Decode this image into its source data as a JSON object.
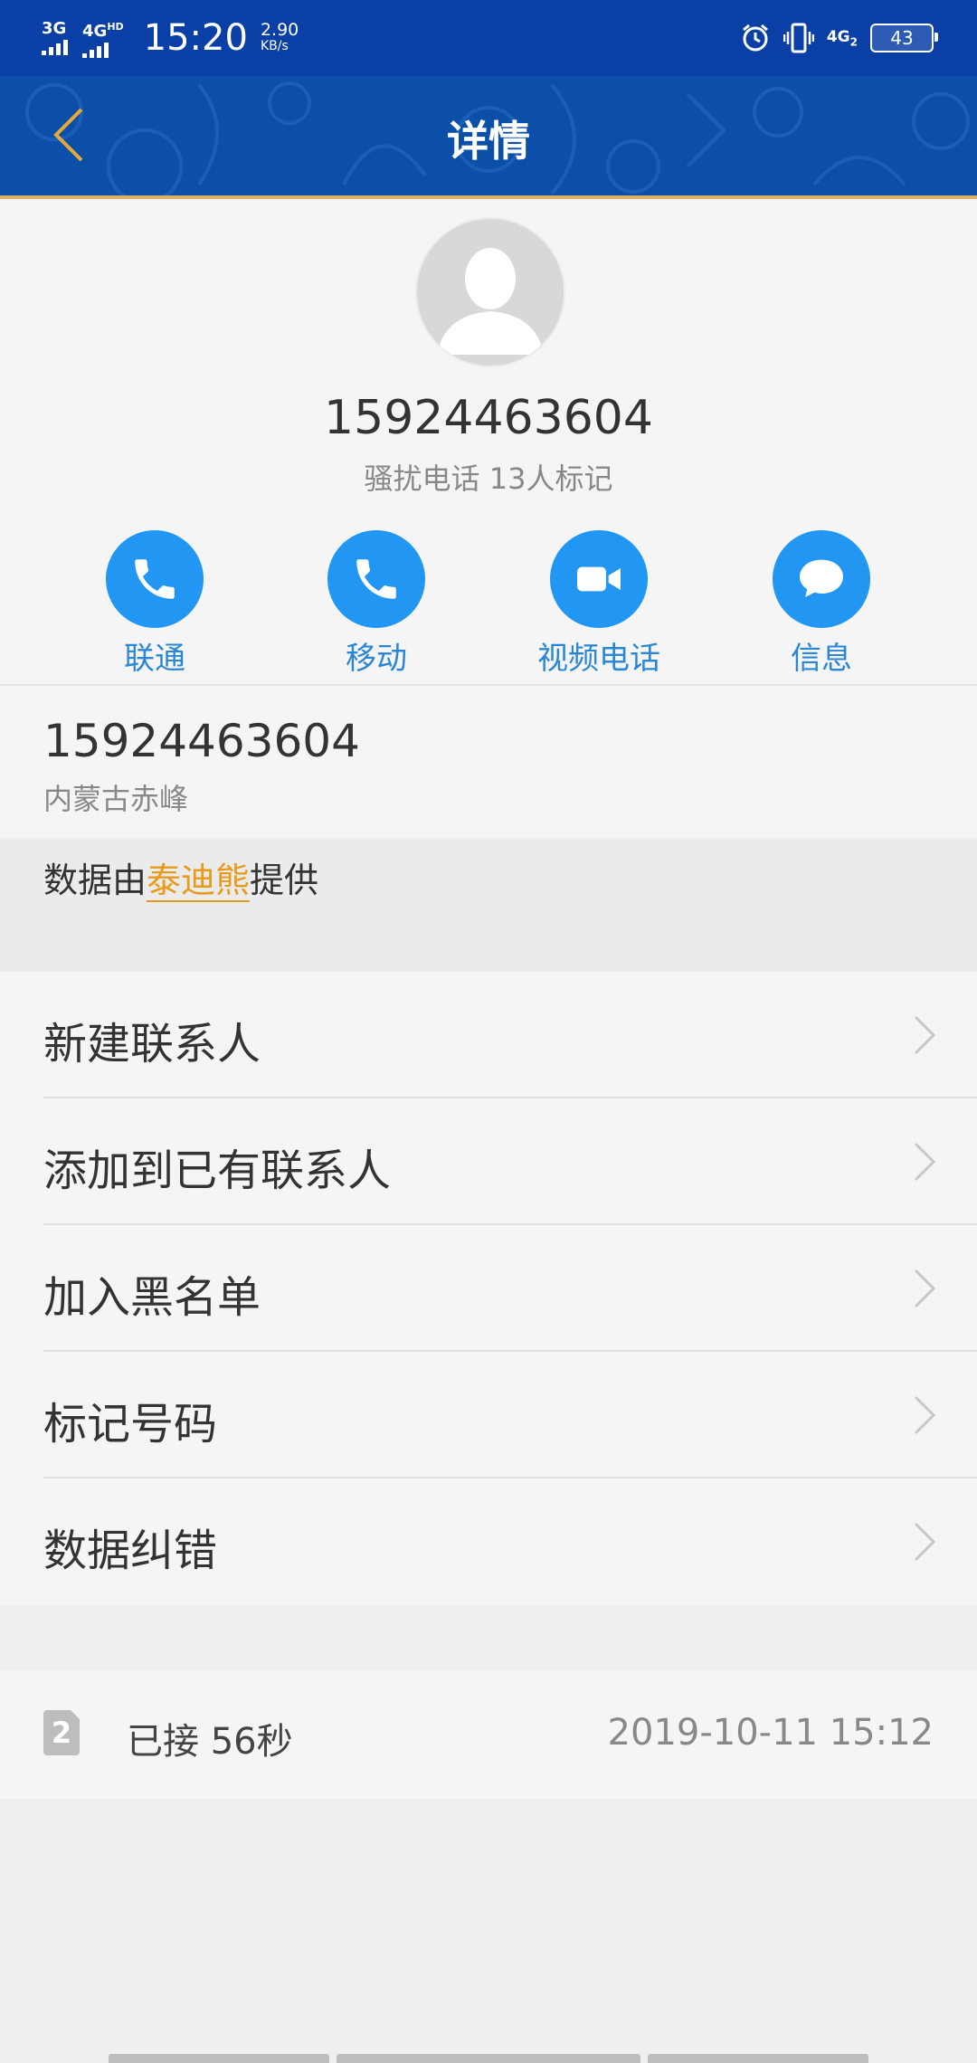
{
  "status_bar": {
    "net1": "3G",
    "net2": "4G",
    "net2_sup": "HD",
    "time": "15:20",
    "speed_value": "2.90",
    "speed_unit": "KB/s",
    "net4g": "4G",
    "net4g_sub": "2",
    "battery": "43",
    "icons": [
      "alarm-icon",
      "vibrate-icon",
      "signal-4g-icon",
      "battery-icon"
    ]
  },
  "header": {
    "title": "详情",
    "back_icon": "back-arrow-icon",
    "accent_color": "#d9b267",
    "background_color": "#0b4fa8"
  },
  "profile": {
    "avatar_icon": "default-avatar-icon",
    "phone": "15924463604",
    "tag_line": "骚扰电话 13人标记"
  },
  "actions": [
    {
      "label": "联通",
      "icon": "phone-icon"
    },
    {
      "label": "移动",
      "icon": "phone-icon"
    },
    {
      "label": "视频电话",
      "icon": "video-icon"
    },
    {
      "label": "信息",
      "icon": "message-icon"
    }
  ],
  "number_info": {
    "number": "15924463604",
    "location": "内蒙古赤峰"
  },
  "provider": {
    "prefix": "数据由",
    "brand": "泰迪熊",
    "suffix": "提供",
    "brand_color": "#e89b1b"
  },
  "menu": [
    {
      "label": "新建联系人"
    },
    {
      "label": "添加到已有联系人"
    },
    {
      "label": "加入黑名单"
    },
    {
      "label": "标记号码"
    },
    {
      "label": "数据纠错"
    }
  ],
  "call_log": {
    "sim": "2",
    "status": "已接 56秒",
    "time": "2019-10-11 15:12"
  }
}
